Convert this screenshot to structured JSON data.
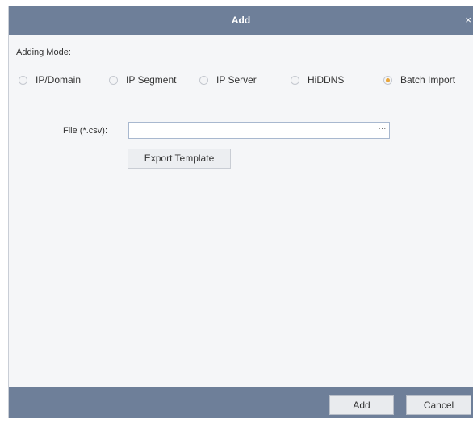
{
  "dialog": {
    "title": "Add",
    "close_glyph": "×",
    "adding_mode_label": "Adding Mode:",
    "modes": [
      {
        "label": "IP/Domain",
        "checked": false
      },
      {
        "label": "IP Segment",
        "checked": false
      },
      {
        "label": "IP Server",
        "checked": false
      },
      {
        "label": "HiDDNS",
        "checked": false
      },
      {
        "label": "Batch Import",
        "checked": true
      }
    ],
    "file_label": "File (*.csv):",
    "file_value": "",
    "browse_label": "···",
    "export_template_label": "Export Template",
    "add_label": "Add",
    "cancel_label": "Cancel"
  },
  "colors": {
    "titlebar": "#6e7f99",
    "radio_checked": "#e8a53a"
  }
}
